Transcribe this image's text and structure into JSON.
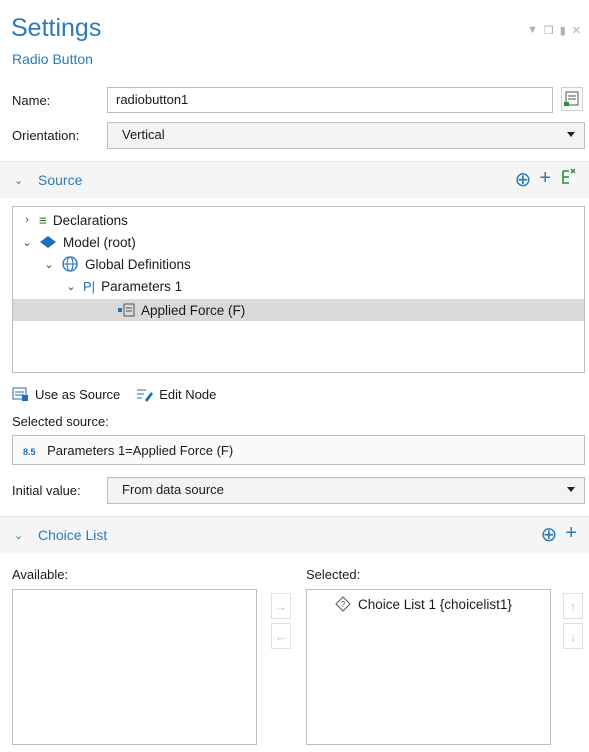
{
  "header": {
    "title": "Settings",
    "subtitle": "Radio Button"
  },
  "name_row": {
    "label": "Name:",
    "value": "radiobutton1"
  },
  "orientation_row": {
    "label": "Orientation:",
    "value": "Vertical"
  },
  "source_section": {
    "title": "Source"
  },
  "tree": {
    "items": [
      {
        "label": "Declarations"
      },
      {
        "label": "Model (root)"
      },
      {
        "label": "Global Definitions"
      },
      {
        "label": "Parameters 1",
        "icon_text": "P|"
      },
      {
        "label": "Applied Force (F)"
      }
    ]
  },
  "toolbar": {
    "use_as_source": "Use as Source",
    "edit_node": "Edit Node"
  },
  "selected_source": {
    "label": "Selected source:",
    "icon_text": "8.5",
    "value": "Parameters 1=Applied Force (F)"
  },
  "initial_value": {
    "label": "Initial value:",
    "value": "From data source"
  },
  "choice_section": {
    "title": "Choice List"
  },
  "choice_lists": {
    "available_label": "Available:",
    "selected_label": "Selected:",
    "selected_items": [
      {
        "label": "Choice List 1 {choicelist1}"
      }
    ]
  },
  "colors": {
    "accent": "#2b7bb9",
    "selection": "#d9d9d9"
  }
}
